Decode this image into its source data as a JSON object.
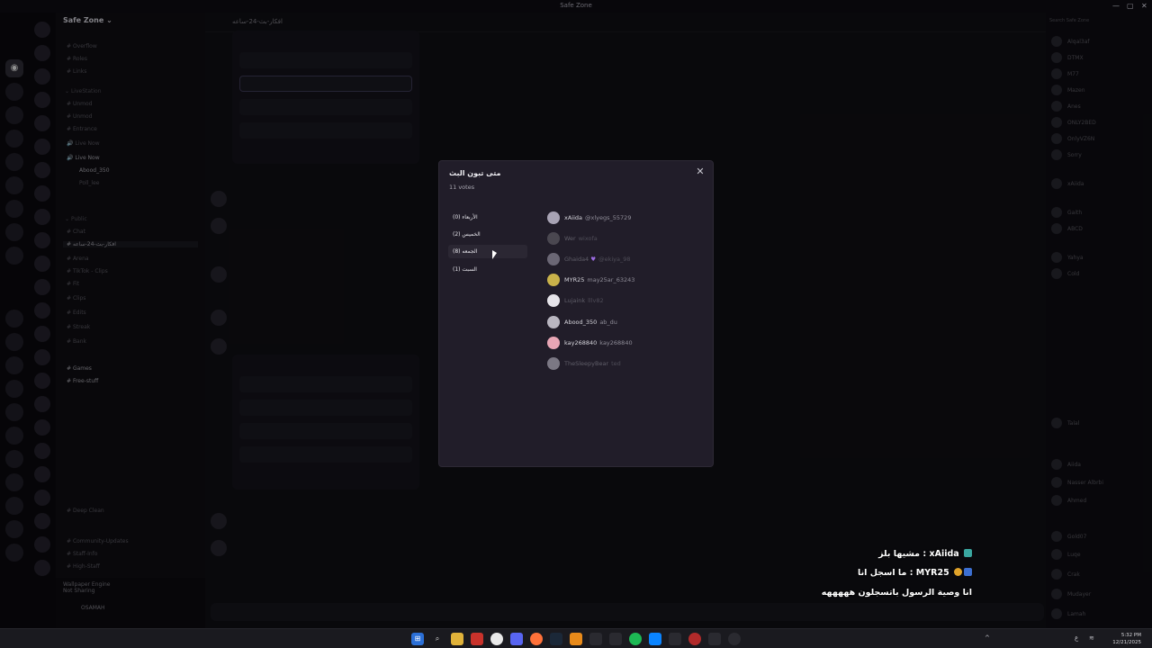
{
  "window": {
    "title": "Safe Zone"
  },
  "server": {
    "name": "Safe Zone"
  },
  "channels": {
    "items": [
      "Overflow",
      "Roles",
      "Links",
      "LiveStation",
      "Unmod",
      "Unmod",
      "Entrance",
      "Live Now",
      "Live Now",
      "Abood_350",
      "Poll_lee",
      "Public",
      "Chat",
      "Arena",
      "TikTok - Clips",
      "Fit",
      "Clips",
      "Edits",
      "Streak",
      "Bank",
      "Games",
      "Free-stuff",
      "Deep Clean",
      "Community-Updates",
      "Staff-Info",
      "High-Staff"
    ],
    "user_panel": {
      "wallpaper": "Wallpaper Engine",
      "status": "Not Sharing",
      "username": "OSAMAH"
    }
  },
  "chat": {
    "channel_name": "افكار-بث-24-ساعه"
  },
  "modal": {
    "title": "متى تبون البث",
    "total_votes": "11 votes",
    "close_label": "✕",
    "answers": [
      {
        "label": "الأربعاء (0)",
        "active": false
      },
      {
        "label": "الخميس (2)",
        "active": false
      },
      {
        "label": "الجمعه (8)",
        "active": true
      },
      {
        "label": "السبت (1)",
        "active": false
      }
    ],
    "voters": [
      {
        "name": "xAiida",
        "username": "@xlyegs_55729",
        "avatar_color": "#a8a3b4",
        "dim": false
      },
      {
        "name": "Wer",
        "username": "wixofa",
        "avatar_color": "#4a4750",
        "dim": true
      },
      {
        "name": "Ghaida4",
        "username": "@ekiya_98",
        "avatar_color": "#6b6775",
        "dim": true
      },
      {
        "name": "MYR25",
        "username": "may25ar_63243",
        "avatar_color": "#c9b24a",
        "dim": false
      },
      {
        "name": "Lujaink",
        "username": "lllv82",
        "avatar_color": "#e6e4ea",
        "dim": true
      },
      {
        "name": "Abood_350",
        "username": "ab_du",
        "avatar_color": "#b9b6c0",
        "dim": false
      },
      {
        "name": "kay268840",
        "username": "kay268840",
        "avatar_color": "#e8a6b5",
        "dim": false
      },
      {
        "name": "TheSleepyBear",
        "username": "ted",
        "avatar_color": "#7b7884",
        "dim": true
      }
    ]
  },
  "members": {
    "search_placeholder": "Search Safe Zone",
    "items": [
      "Alqal3af",
      "DTMX",
      "M77",
      "Mazen",
      "Anes",
      "ONLY2BED",
      "OnlyVZ6N",
      "Sorry",
      "xAiida",
      "Gaith",
      "ABCD",
      "Yahya",
      "Cold",
      "Talal",
      "Aiida",
      "Nasser Albrbi",
      "Ahmed",
      "Gold07",
      "Luqe",
      "Crak",
      "Mudayer",
      "Lamah"
    ]
  },
  "stream_overlay": {
    "line1": "مشيها بلز : xAiida",
    "line2": "ما اسجل انا : MYR25",
    "line3": "انا وصية الرسول باتسجلون هههههه"
  },
  "taskbar": {
    "time": "5:32 PM",
    "date": "12/21/2025",
    "lang": "ع"
  }
}
